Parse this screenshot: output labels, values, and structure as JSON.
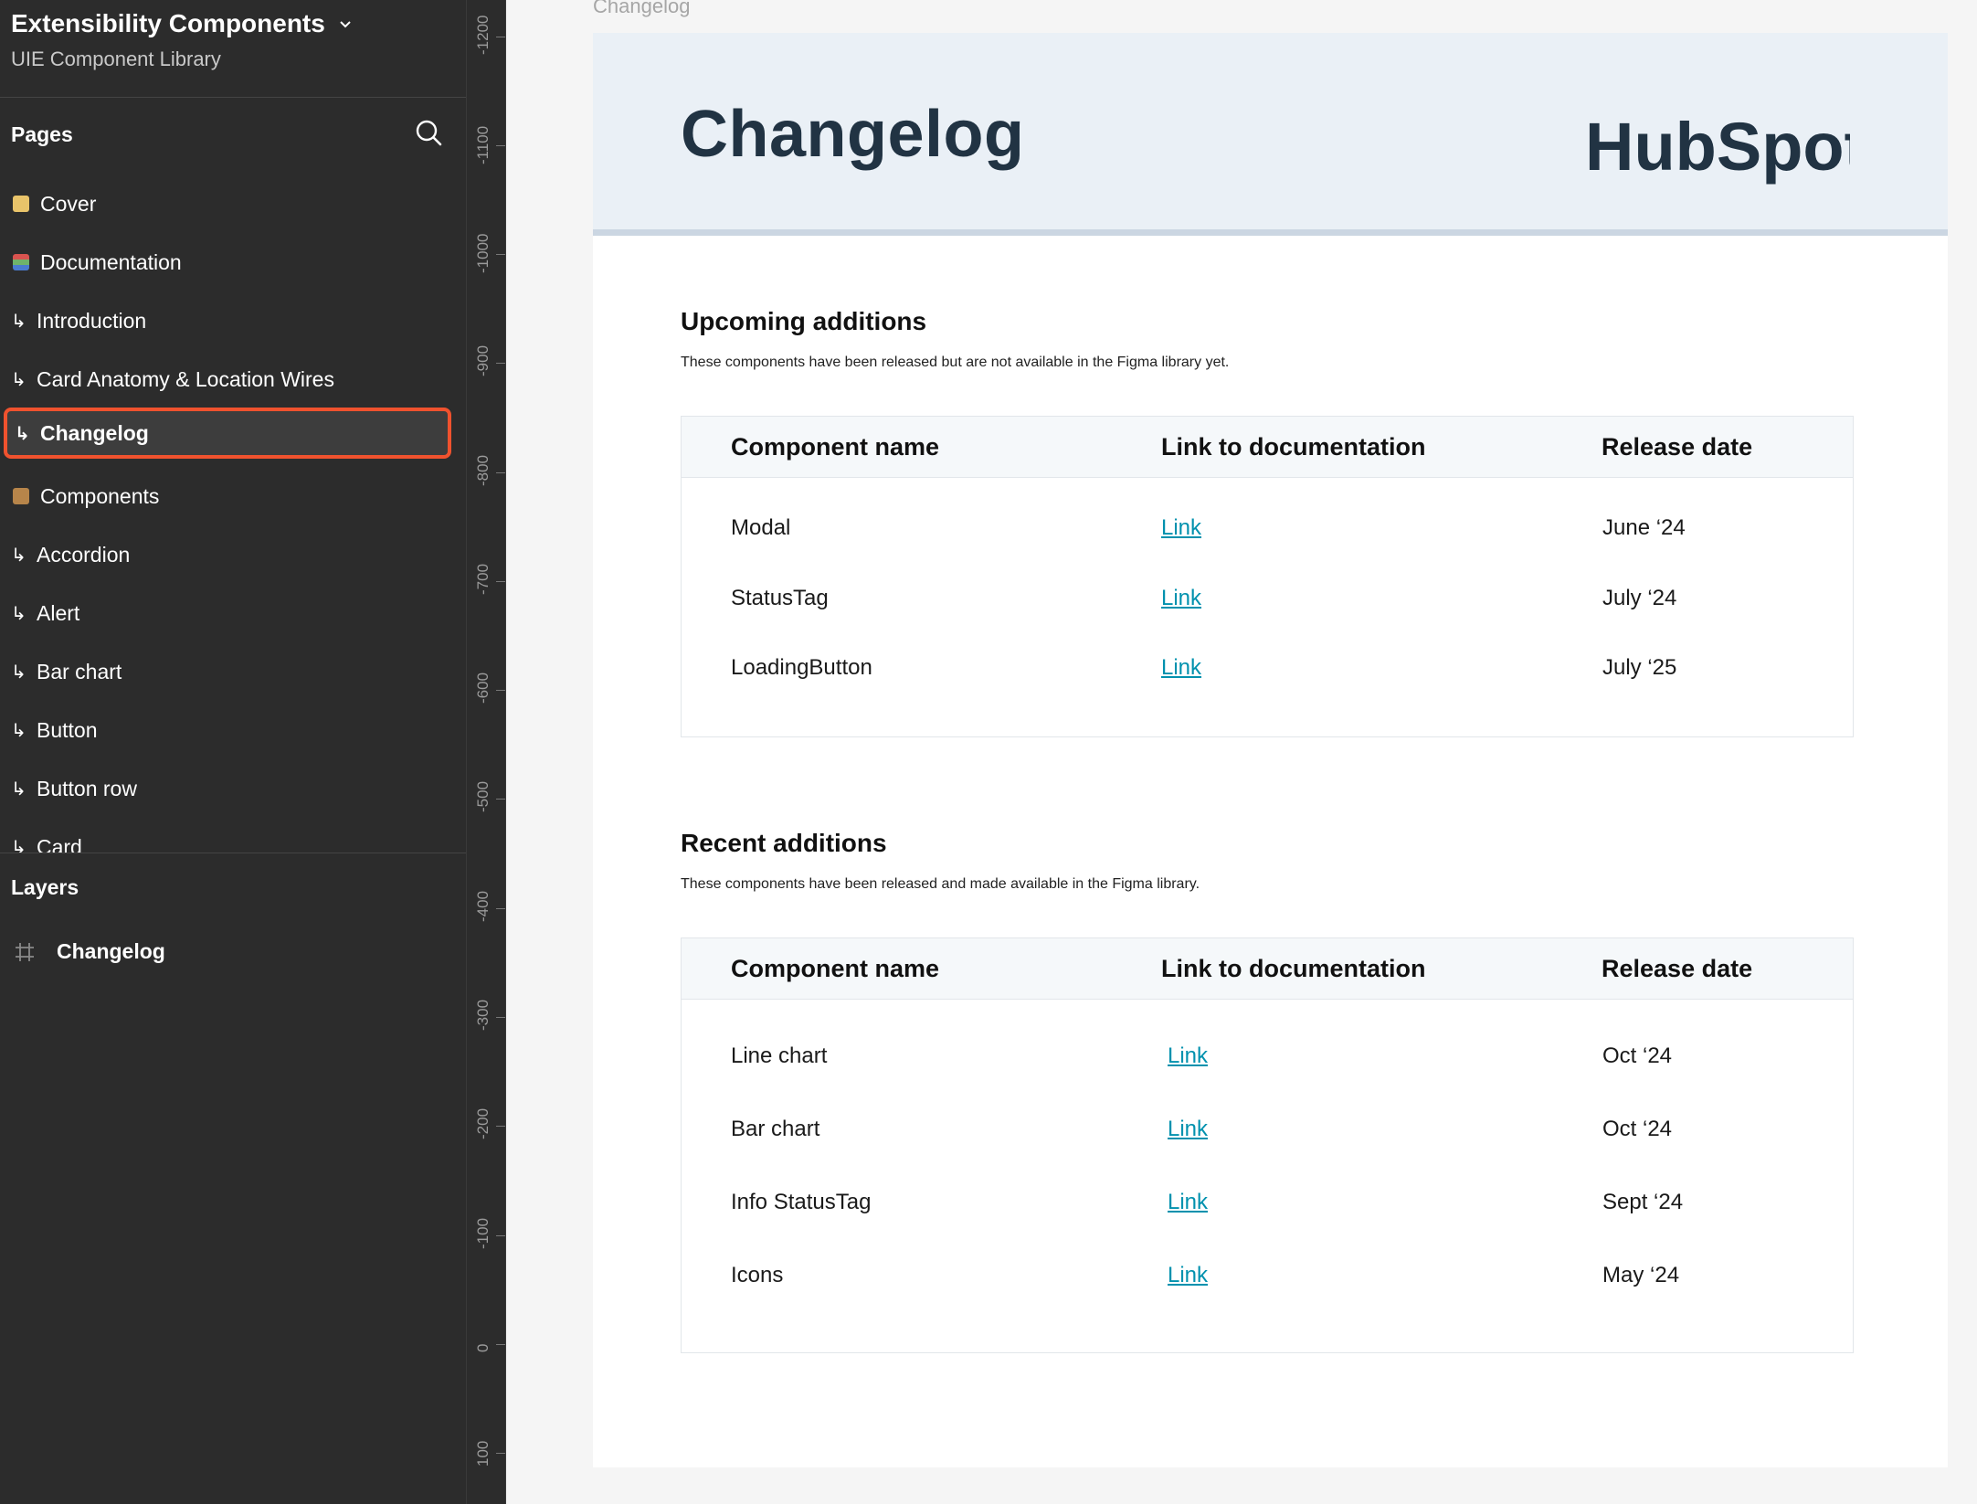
{
  "file": {
    "title": "Extensibility Components",
    "subtitle": "UIE Component Library"
  },
  "pages_panel": {
    "title": "Pages",
    "items": [
      {
        "glyph": "emoji",
        "color": "#e9c46a",
        "label": "Cover"
      },
      {
        "glyph": "emoji",
        "color": "#6fb36b",
        "label": "Documentation"
      },
      {
        "glyph": "↳",
        "label": "Introduction"
      },
      {
        "glyph": "↳",
        "label": "Card Anatomy & Location Wires"
      },
      {
        "glyph": "↳",
        "label": "Changelog",
        "selected": true
      },
      {
        "glyph": "emoji",
        "color": "#b7854a",
        "label": "Components"
      },
      {
        "glyph": "↳",
        "label": "Accordion"
      },
      {
        "glyph": "↳",
        "label": "Alert"
      },
      {
        "glyph": "↳",
        "label": "Bar chart"
      },
      {
        "glyph": "↳",
        "label": "Button"
      },
      {
        "glyph": "↳",
        "label": "Button row"
      },
      {
        "glyph": "↳",
        "label": "Card"
      }
    ]
  },
  "layers_panel": {
    "title": "Layers",
    "items": [
      {
        "label": "Changelog",
        "icon": "frame-icon"
      }
    ]
  },
  "ruler": {
    "labels": [
      "-1200",
      "-1100",
      "-1000",
      "-900",
      "-800",
      "-700",
      "-600",
      "-500",
      "-400",
      "-300",
      "-200",
      "-100",
      "0",
      "100"
    ]
  },
  "canvas": {
    "frame_label": "Changelog",
    "banner_title": "Changelog",
    "logo_text": "HubSpot",
    "accent": "#ff5c35",
    "upcoming": {
      "title": "Upcoming additions",
      "description": "These components have been released but are not available in the Figma library yet.",
      "headers": [
        "Component name",
        "Link to documentation",
        "Release date"
      ],
      "rows": [
        {
          "name": "Modal",
          "link": "Link",
          "date": "June ‘24"
        },
        {
          "name": "StatusTag",
          "link": "Link",
          "date": "July ‘24"
        },
        {
          "name": "LoadingButton",
          "link": "Link",
          "date": "July ‘25"
        }
      ]
    },
    "recent": {
      "title": "Recent additions",
      "description": "These components have been released and made available in the Figma library.",
      "headers": [
        "Component name",
        "Link to documentation",
        "Release date"
      ],
      "rows": [
        {
          "name": "Line chart",
          "link": "Link",
          "date": "Oct ‘24"
        },
        {
          "name": "Bar chart",
          "link": "Link",
          "date": "Oct ‘24"
        },
        {
          "name": "Info StatusTag",
          "link": "Link",
          "date": "Sept ‘24"
        },
        {
          "name": "Icons",
          "link": "Link",
          "date": "May ‘24"
        }
      ]
    }
  }
}
